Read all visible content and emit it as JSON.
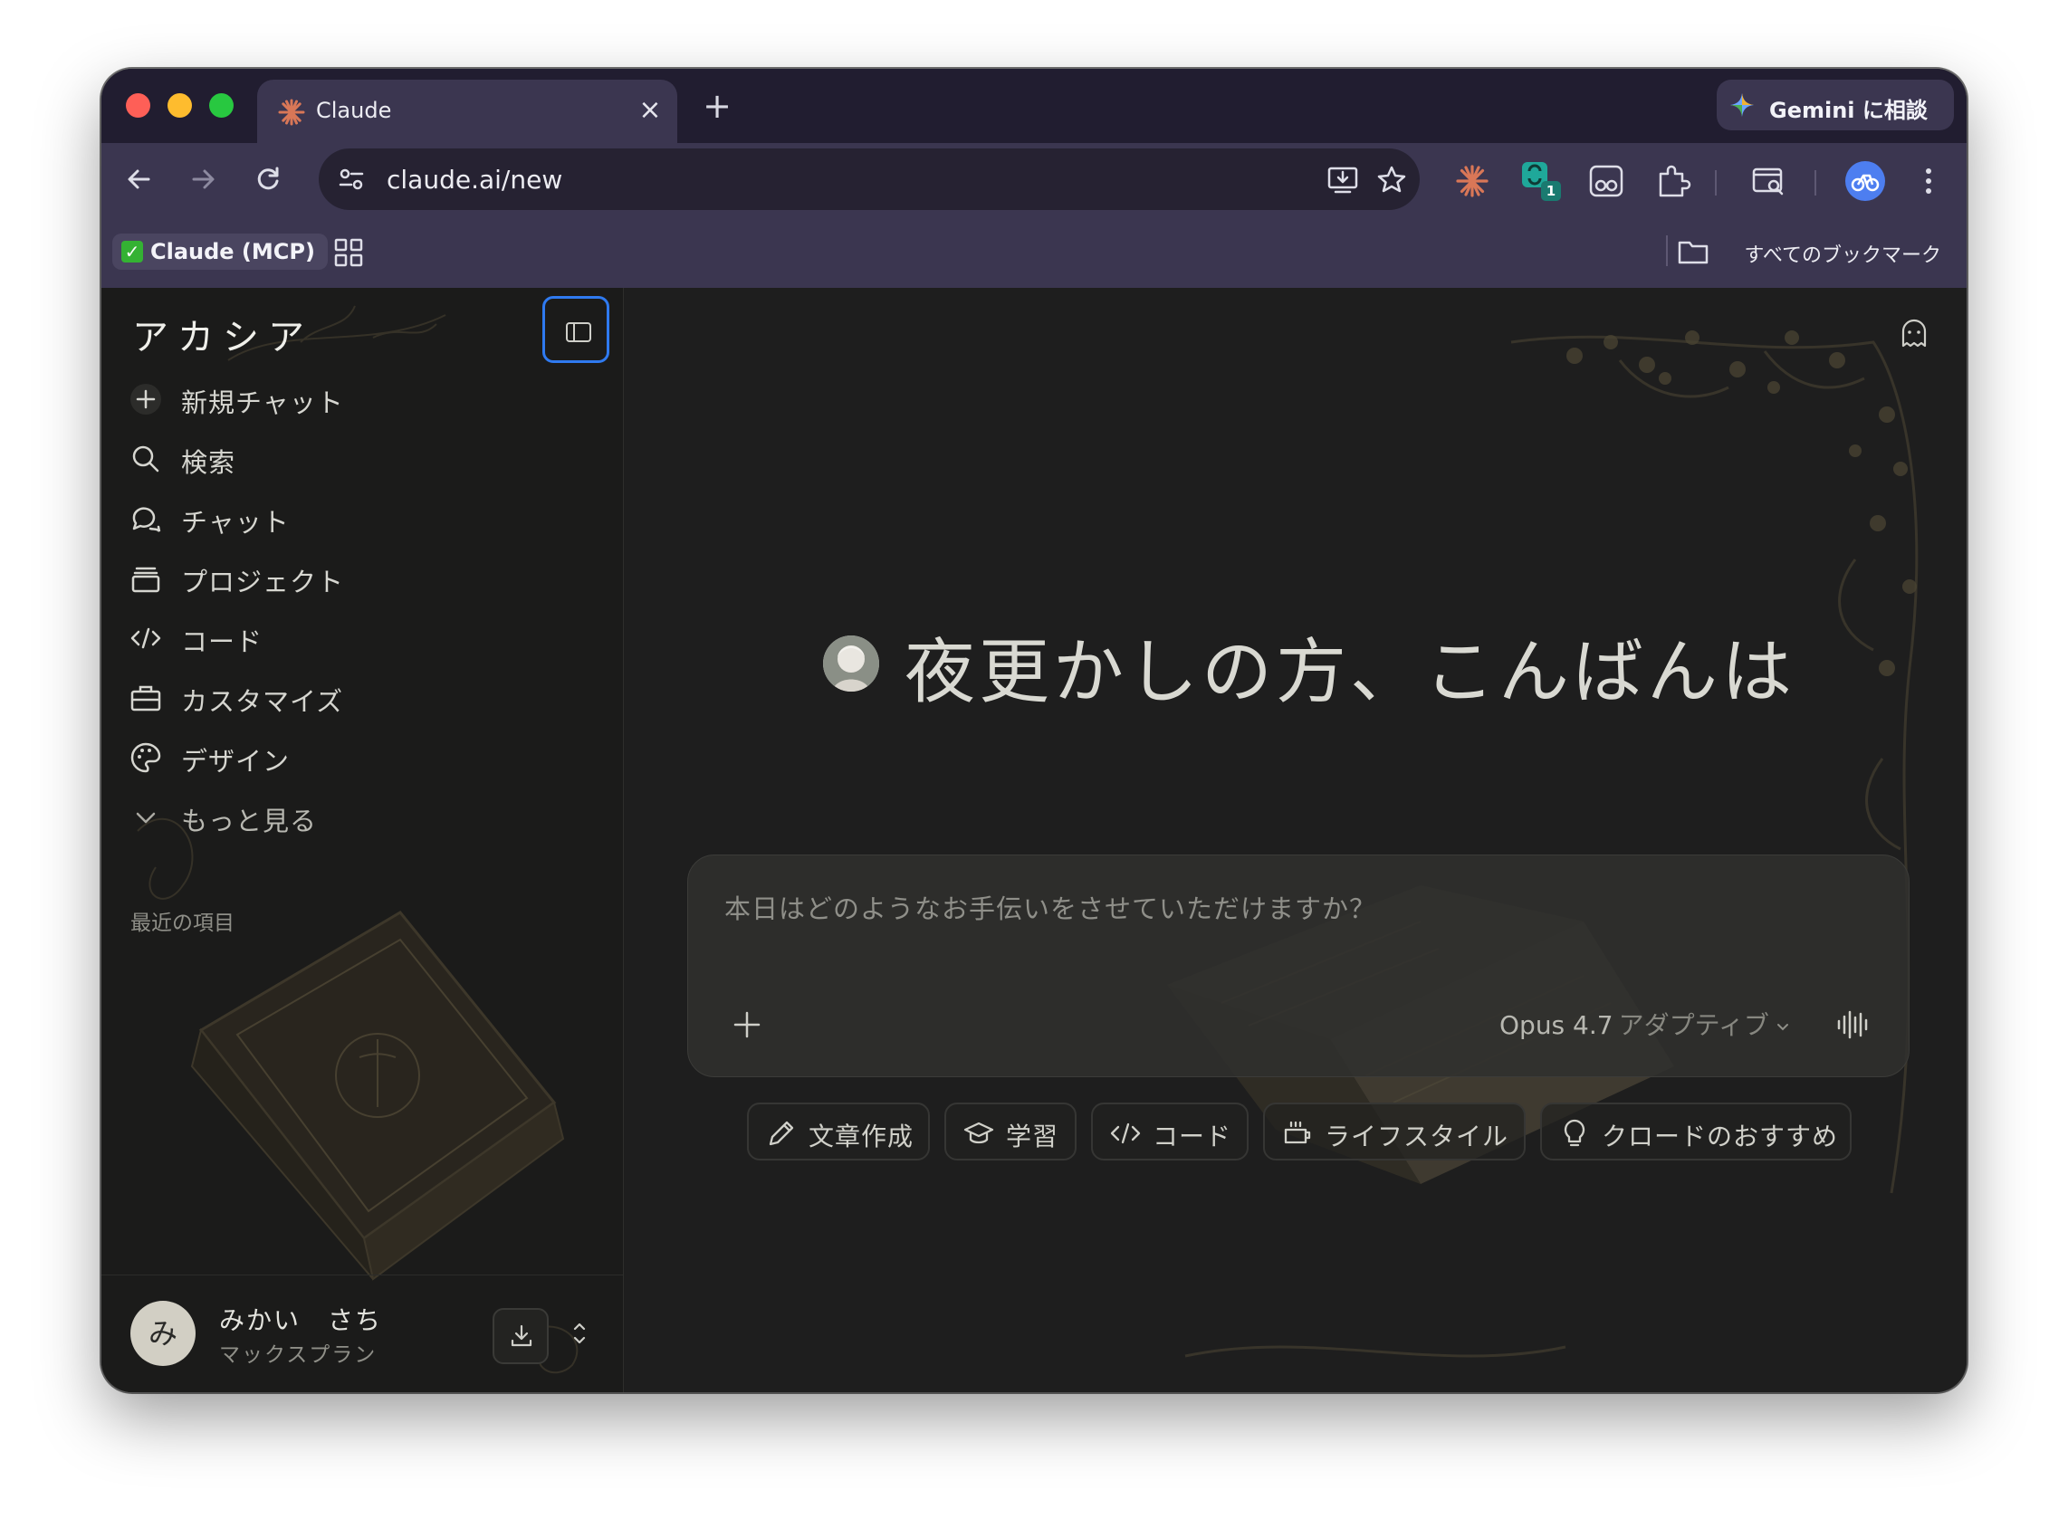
{
  "browser": {
    "tab": {
      "title": "Claude"
    },
    "gemini_button": {
      "label": "Gemini に相談"
    },
    "address_bar": {
      "url": "claude.ai/new"
    },
    "extension_badge": "1",
    "bookmarks": {
      "chip_label": "Claude (MCP)",
      "all_bookmarks_label": "すべてのブックマーク"
    }
  },
  "sidebar": {
    "brand": "アカシア",
    "items": [
      {
        "label": "新規チャット",
        "icon": "plus-icon"
      },
      {
        "label": "検索",
        "icon": "search-icon"
      },
      {
        "label": "チャット",
        "icon": "chat-bubbles-icon"
      },
      {
        "label": "プロジェクト",
        "icon": "folder-stack-icon"
      },
      {
        "label": "コード",
        "icon": "code-icon"
      },
      {
        "label": "カスタマイズ",
        "icon": "briefcase-icon"
      },
      {
        "label": "デザイン",
        "icon": "palette-icon"
      },
      {
        "label": "もっと見る",
        "icon": "chevron-down-icon"
      }
    ],
    "recent_heading": "最近の項目",
    "user": {
      "initial": "み",
      "name": "みかい　さち",
      "plan": "マックスプラン"
    }
  },
  "main": {
    "greeting": "夜更かしの方、こんばんは",
    "composer": {
      "placeholder": "本日はどのようなお手伝いをさせていただけますか？",
      "model": "Opus 4.7",
      "mode": "アダプティブ"
    },
    "chips": [
      {
        "label": "文章作成",
        "icon": "pencil-icon"
      },
      {
        "label": "学習",
        "icon": "graduation-cap-icon"
      },
      {
        "label": "コード",
        "icon": "code-icon"
      },
      {
        "label": "ライフスタイル",
        "icon": "coffee-cup-icon"
      },
      {
        "label": "クロードのおすすめ",
        "icon": "lightbulb-icon"
      }
    ]
  },
  "colors": {
    "accent_focus": "#2f7af0",
    "claude_orange": "#d97757",
    "tab_strip": "#211d30",
    "toolbar": "#3b3650",
    "page_background": "#1e1e1e"
  }
}
